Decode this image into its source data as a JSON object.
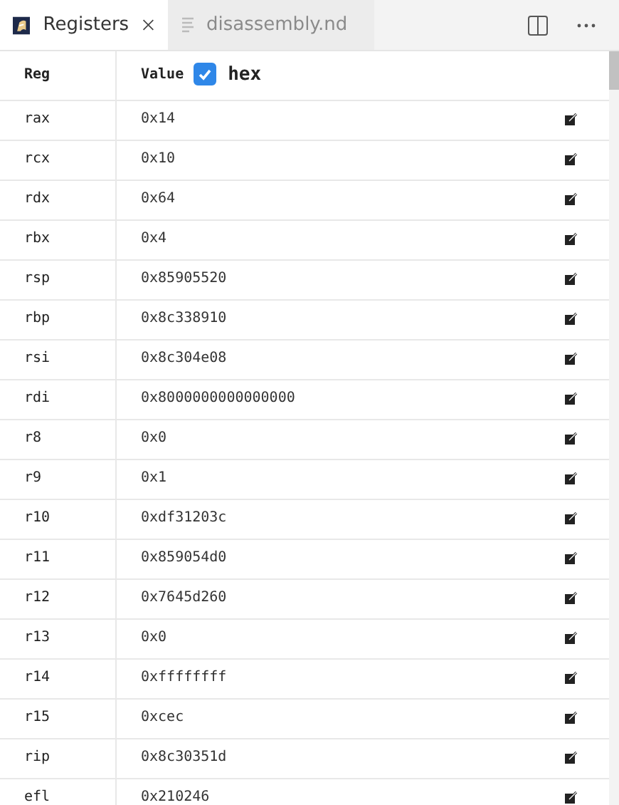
{
  "tabs": [
    {
      "label": "Registers",
      "selected": true,
      "kind": "registers"
    },
    {
      "label": "disassembly.nd",
      "selected": false,
      "kind": "file"
    }
  ],
  "table": {
    "columns": [
      "Reg",
      "Value"
    ],
    "hex": {
      "label": "hex",
      "checked": true
    },
    "rows": [
      {
        "reg": "rax",
        "value": "0x14"
      },
      {
        "reg": "rcx",
        "value": "0x10"
      },
      {
        "reg": "rdx",
        "value": "0x64"
      },
      {
        "reg": "rbx",
        "value": "0x4"
      },
      {
        "reg": "rsp",
        "value": "0x85905520"
      },
      {
        "reg": "rbp",
        "value": "0x8c338910"
      },
      {
        "reg": "rsi",
        "value": "0x8c304e08"
      },
      {
        "reg": "rdi",
        "value": "0x8000000000000000"
      },
      {
        "reg": "r8",
        "value": "0x0"
      },
      {
        "reg": "r9",
        "value": "0x1"
      },
      {
        "reg": "r10",
        "value": "0xdf31203c"
      },
      {
        "reg": "r11",
        "value": "0x859054d0"
      },
      {
        "reg": "r12",
        "value": "0x7645d260"
      },
      {
        "reg": "r13",
        "value": "0x0"
      },
      {
        "reg": "r14",
        "value": "0xffffffff"
      },
      {
        "reg": "r15",
        "value": "0xcec"
      },
      {
        "reg": "rip",
        "value": "0x8c30351d"
      },
      {
        "reg": "efl",
        "value": "0x210246"
      }
    ]
  }
}
